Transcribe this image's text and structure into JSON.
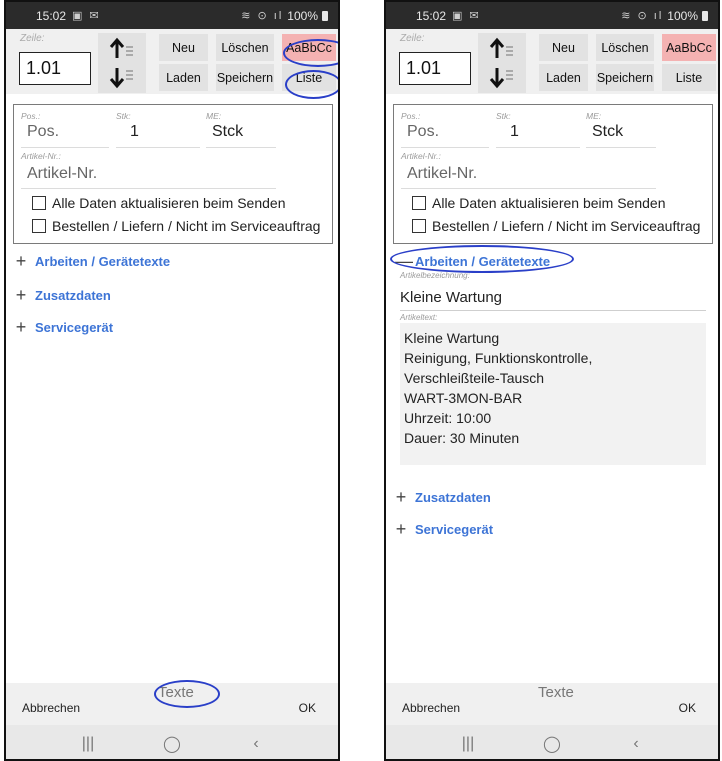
{
  "status": {
    "time": "15:02",
    "left_icons": "▣ ✉",
    "signal": "≋ ⊙ ıl",
    "battery": "100%"
  },
  "toolbar": {
    "zeile_label": "Zeile:",
    "zeile_value": "1.01",
    "neu": "Neu",
    "loeschen": "Löschen",
    "aabbcc": "AaBbCc",
    "laden": "Laden",
    "speichern": "Speichern",
    "liste": "Liste"
  },
  "form": {
    "pos_label": "Pos.:",
    "pos_placeholder": "Pos.",
    "stk_label": "Stk:",
    "stk_value": "1",
    "me_label": "ME:",
    "me_value": "Stck",
    "artikel_label": "Artikel-Nr.:",
    "artikel_placeholder": "Artikel-Nr.",
    "check1": "Alle Daten aktualisieren beim Senden",
    "check2": "Bestellen / Liefern / Nicht im Serviceauftrag"
  },
  "sections": {
    "arbeiten": "Arbeiten / Gerätetexte",
    "zusatz": "Zusatzdaten",
    "service": "Servicegerät",
    "plus": "+",
    "minus": "—"
  },
  "arbeiten_expanded": {
    "bez_label": "Artikelbezeichnung:",
    "bez_value": "Kleine Wartung",
    "text_label": "Artikeltext:",
    "text_lines": [
      "Kleine Wartung",
      "Reinigung, Funktionskontrolle,",
      "Verschleißteile-Tausch",
      "WART-3MON-BAR",
      "Uhrzeit: 10:00",
      "Dauer: 30 Minuten"
    ]
  },
  "bottom": {
    "abbrechen": "Abbrechen",
    "texte": "Texte",
    "ok": "OK"
  },
  "nav": {
    "recents": "|||",
    "home": "◯",
    "back": "‹"
  },
  "colors": {
    "accent_blue": "#3d74d6",
    "highlight_pink": "#f4b2b2",
    "annotation_blue": "#2a3fc8"
  },
  "icons": {
    "toolbar_up": "arrow-up-lines-icon",
    "toolbar_down": "arrow-down-lines-icon",
    "nav_recents": "recents-icon",
    "nav_home": "home-icon",
    "nav_back": "back-icon"
  }
}
